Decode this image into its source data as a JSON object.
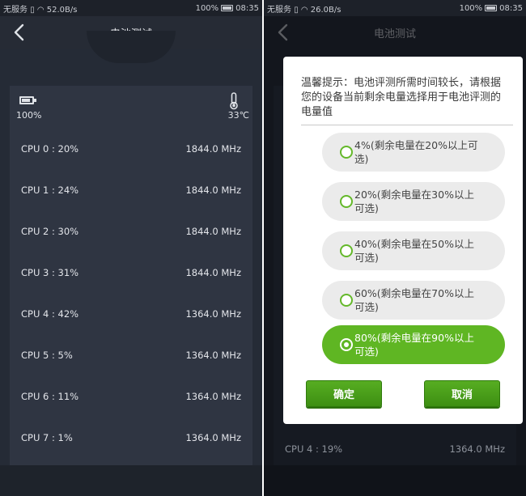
{
  "status_bar": {
    "left_carrier": "无服务",
    "left_speed": "52.0B/s",
    "right_speed": "26.0B/s",
    "battery": "100%",
    "time": "08:35"
  },
  "header": {
    "title": "电池测试"
  },
  "summary": {
    "battery_percent": "100%",
    "temperature": "33℃"
  },
  "cpu_rows": [
    {
      "label": "CPU 0 : 20%",
      "freq": "1844.0 MHz"
    },
    {
      "label": "CPU 1 : 24%",
      "freq": "1844.0 MHz"
    },
    {
      "label": "CPU 2 : 30%",
      "freq": "1844.0 MHz"
    },
    {
      "label": "CPU 3 : 31%",
      "freq": "1844.0 MHz"
    },
    {
      "label": "CPU 4 : 42%",
      "freq": "1364.0 MHz"
    },
    {
      "label": "CPU 5 : 5%",
      "freq": "1364.0 MHz"
    },
    {
      "label": "CPU 6 : 11%",
      "freq": "1364.0 MHz"
    },
    {
      "label": "CPU 7 : 1%",
      "freq": "1364.0 MHz"
    }
  ],
  "background_row": {
    "label": "CPU 4 : 19%",
    "freq": "1364.0 MHz"
  },
  "dialog": {
    "message": "温馨提示：电池评测所需时间较长，请根据您的设备当前剩余电量选择用于电池评测的电量值",
    "options": [
      {
        "label": "4%(剩余电量在20%以上可选)",
        "selected": false
      },
      {
        "label": "20%(剩余电量在30%以上可选)",
        "selected": false
      },
      {
        "label": "40%(剩余电量在50%以上可选)",
        "selected": false
      },
      {
        "label": "60%(剩余电量在70%以上可选)",
        "selected": false
      },
      {
        "label": "80%(剩余电量在90%以上可选)",
        "selected": true
      }
    ],
    "confirm_label": "确定",
    "cancel_label": "取消"
  },
  "colors": {
    "accent_green": "#5fb623",
    "screen_bg": "#252b36",
    "panel_bg": "#2f3542"
  }
}
